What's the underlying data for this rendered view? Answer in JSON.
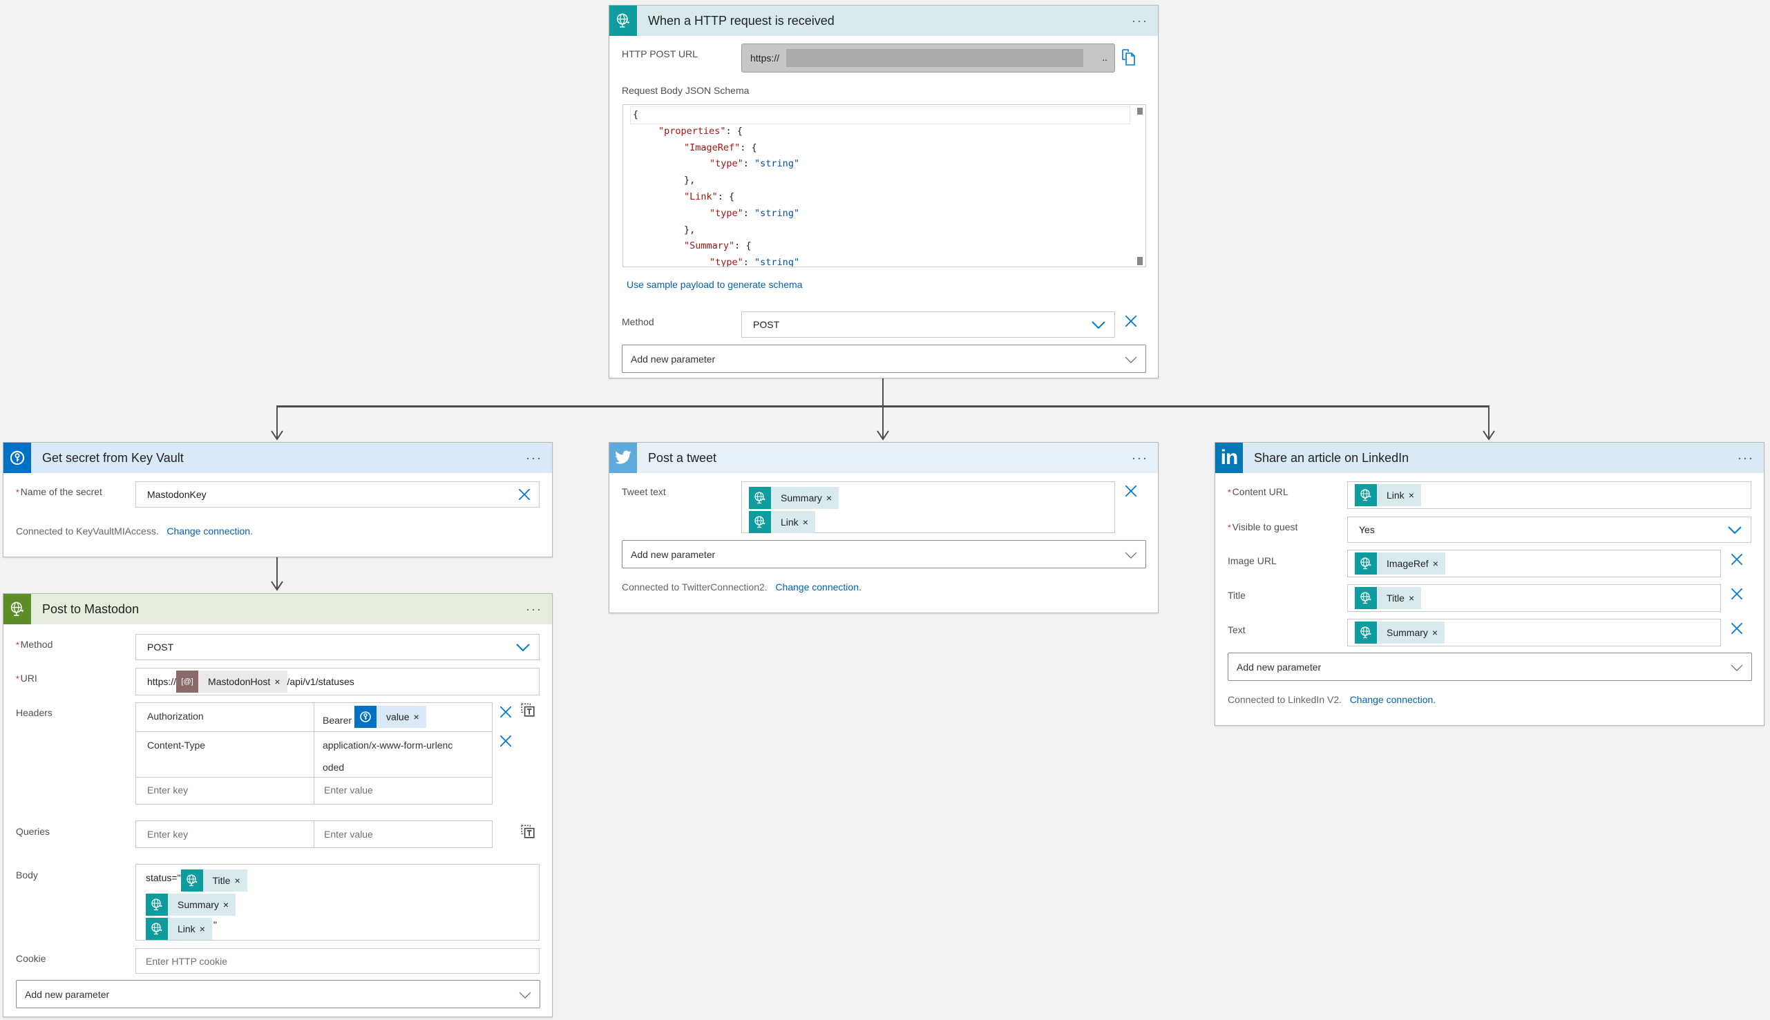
{
  "colors": {
    "http_teal": "#0e9c9e",
    "keyvault_blue": "#0072c6",
    "mastodon_green": "#5c8d27",
    "twitter_blue": "#5ea9dd",
    "linkedin_blue": "#0077b5",
    "link_blue": "#0062ad",
    "x_blue": "#0078d4"
  },
  "trigger": {
    "title": "When a HTTP request is received",
    "icon": "http-globe-icon",
    "http_post_url_label": "HTTP POST URL",
    "http_post_url_value": "https://",
    "http_post_url_ellipsis": "..",
    "schema_label": "Request Body JSON Schema",
    "schema_lines": [
      {
        "indent": 0,
        "parts": [
          {
            "t": "p",
            "v": "{"
          }
        ]
      },
      {
        "indent": 1,
        "parts": [
          {
            "t": "k",
            "v": "\"properties\""
          },
          {
            "t": "p",
            "v": ": {"
          }
        ]
      },
      {
        "indent": 2,
        "parts": [
          {
            "t": "k",
            "v": "\"ImageRef\""
          },
          {
            "t": "p",
            "v": ": {"
          }
        ]
      },
      {
        "indent": 3,
        "parts": [
          {
            "t": "k",
            "v": "\"type\""
          },
          {
            "t": "p",
            "v": ": "
          },
          {
            "t": "s",
            "v": "\"string\""
          }
        ]
      },
      {
        "indent": 2,
        "parts": [
          {
            "t": "p",
            "v": "},"
          }
        ]
      },
      {
        "indent": 2,
        "parts": [
          {
            "t": "k",
            "v": "\"Link\""
          },
          {
            "t": "p",
            "v": ": {"
          }
        ]
      },
      {
        "indent": 3,
        "parts": [
          {
            "t": "k",
            "v": "\"type\""
          },
          {
            "t": "p",
            "v": ": "
          },
          {
            "t": "s",
            "v": "\"string\""
          }
        ]
      },
      {
        "indent": 2,
        "parts": [
          {
            "t": "p",
            "v": "},"
          }
        ]
      },
      {
        "indent": 2,
        "parts": [
          {
            "t": "k",
            "v": "\"Summary\""
          },
          {
            "t": "p",
            "v": ": {"
          }
        ]
      },
      {
        "indent": 3,
        "parts": [
          {
            "t": "k",
            "v": "\"type\""
          },
          {
            "t": "p",
            "v": ": "
          },
          {
            "t": "s",
            "v": "\"string\""
          }
        ]
      }
    ],
    "sample_payload_link": "Use sample payload to generate schema",
    "method_label": "Method",
    "method_value": "POST",
    "add_param": "Add new parameter"
  },
  "keyvault": {
    "title": "Get secret from Key Vault",
    "secret_label": "Name of the secret",
    "secret_value": "MastodonKey",
    "connected_text": "Connected to KeyVaultMIAccess.",
    "change_connection": "Change connection."
  },
  "mastodon": {
    "title": "Post to Mastodon",
    "method_label": "Method",
    "method_value": "POST",
    "uri_label": "URI",
    "uri_prefix": "https://",
    "uri_token": "MastodonHost",
    "uri_suffix": "/api/v1/statuses",
    "headers_label": "Headers",
    "headers": [
      {
        "key": "Authorization",
        "value_prefix": "Bearer",
        "value_token": "value"
      },
      {
        "key": "Content-Type",
        "value_line1": "application/x-www-form-urlenc",
        "value_line2": "oded"
      }
    ],
    "enter_key": "Enter key",
    "enter_value": "Enter value",
    "queries_label": "Queries",
    "body_label": "Body",
    "body_prefix": "status=\"",
    "body_tokens": [
      "Title",
      "Summary",
      "Link"
    ],
    "body_suffix": "\"",
    "cookie_label": "Cookie",
    "cookie_placeholder": "Enter HTTP cookie",
    "add_param": "Add new parameter"
  },
  "twitter": {
    "title": "Post a tweet",
    "tweet_label": "Tweet text",
    "tweet_tokens": [
      "Summary",
      "Link"
    ],
    "add_param": "Add new parameter",
    "connected_text": "Connected to TwitterConnection2.",
    "change_connection": "Change connection."
  },
  "linkedin": {
    "title": "Share an article on LinkedIn",
    "content_url_label": "Content URL",
    "content_url_token": "Link",
    "visible_label": "Visible to guest",
    "visible_value": "Yes",
    "image_url_label": "Image URL",
    "image_url_token": "ImageRef",
    "title_label": "Title",
    "title_token": "Title",
    "text_label": "Text",
    "text_token": "Summary",
    "add_param": "Add new parameter",
    "connected_text": "Connected to LinkedIn V2.",
    "change_connection": "Change connection."
  },
  "token_close": "×",
  "more_label": "···"
}
